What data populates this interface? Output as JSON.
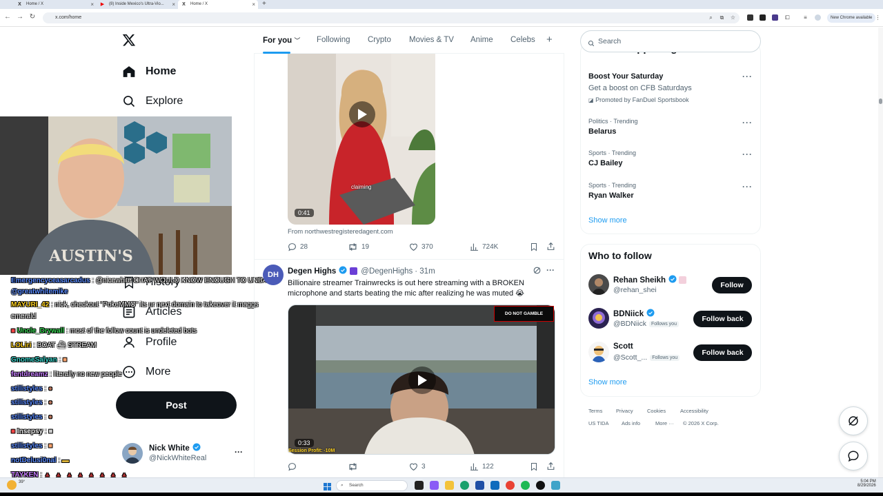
{
  "browser": {
    "tabs": [
      {
        "title": "Home / X",
        "active": false,
        "icon": "x-icon"
      },
      {
        "title": "(8) Inside Mexico's Ultra-Vio...",
        "active": false,
        "icon": "youtube-icon"
      },
      {
        "title": "Home / X",
        "active": true,
        "icon": "x-icon"
      }
    ],
    "url": "x.com/home",
    "new_chrome_badge": "New Chrome available"
  },
  "left_nav": {
    "items": [
      {
        "label": "Home",
        "icon": "home-icon",
        "active": true
      },
      {
        "label": "Explore",
        "icon": "search-icon"
      },
      {
        "label": "History",
        "icon": "bookmark-icon"
      },
      {
        "label": "Articles",
        "icon": "article-icon"
      },
      {
        "label": "Profile",
        "icon": "person-icon"
      },
      {
        "label": "More",
        "icon": "more-circle-icon"
      }
    ],
    "post_label": "Post",
    "account": {
      "name": "Nick White",
      "handle": "@NickWhiteReal"
    }
  },
  "stream_chat": [
    {
      "user": "Emergencyceasarcadus",
      "color": "#5b8cff",
      "msg": ": @nicewhite CHAT WOULD KNOW ENOUGH TO UNBAN"
    },
    {
      "user": "@greatwhitemike",
      "color": "#5b8cff",
      "msg": ""
    },
    {
      "user": "MAYURI_42",
      "color": "#ffd21f",
      "msg": ": nick, checkout \"PokeMMO\" its ur next domain to takeover it maggs"
    },
    {
      "user": "",
      "color": "#ffffff",
      "msg": "emerald"
    },
    {
      "user": "Uncle_Drywall",
      "color": "#39d353",
      "msg": ": most of the follow count is undeleted bots"
    },
    {
      "user": "LOLiri",
      "color": "#ffd21f",
      "msg": ": BOAT ⛴ STREAM"
    },
    {
      "user": "GnomeSalyan",
      "color": "#39d3c9",
      "msg": ":"
    },
    {
      "user": "fentdreamz",
      "color": "#c77dff",
      "msg": ": literally no new people"
    },
    {
      "user": "stilistyles",
      "color": "#5b8cff",
      "msg": ":"
    },
    {
      "user": "stilistyles",
      "color": "#5b8cff",
      "msg": ":"
    },
    {
      "user": "stilistyles",
      "color": "#5b8cff",
      "msg": ":"
    },
    {
      "user": "Insepsy",
      "color": "#f2f2f2",
      "msg": ":"
    },
    {
      "user": "stilistyles",
      "color": "#5b8cff",
      "msg": ":"
    },
    {
      "user": "notDelusi0nal",
      "color": "#5b8cff",
      "msg": ":"
    },
    {
      "user": "TAYKEN",
      "color": "#c77dff",
      "msg": ":"
    },
    {
      "user": "stilistyles",
      "color": "#5b8cff",
      "msg": ":"
    }
  ],
  "feed": {
    "tabs": [
      "For you",
      "Following",
      "Crypto",
      "Movies & TV",
      "Anime",
      "Celebs"
    ],
    "tweet1": {
      "video_caption": "claiming",
      "duration": "0:41",
      "source": "From northwestregisteredagent.com",
      "replies": "28",
      "reposts": "19",
      "likes": "370",
      "views": "724K"
    },
    "tweet2": {
      "avatar_text": "DH",
      "name": "Degen Highs",
      "handle": "@DegenHighs",
      "time": "· 31m",
      "text": "Billionaire streamer Trainwrecks is out here streaming with a BROKEN microphone and starts beating the mic after realizing he was muted 😭",
      "overlay_badge": "DO NOT GAMBLE",
      "session_profit": "Session Profit: -10M",
      "duration": "0:33",
      "replies": "",
      "reposts": "",
      "likes": "3",
      "views": "122"
    }
  },
  "right": {
    "search_placeholder": "Search",
    "whats_happening_title": "What's happening",
    "trends": [
      {
        "meta": "",
        "title": "Boost Your Saturday",
        "sub": "Get a boost on CFB Saturdays",
        "promoted": "Promoted by FanDuel Sportsbook"
      },
      {
        "meta": "Politics · Trending",
        "title": "Belarus"
      },
      {
        "meta": "Sports · Trending",
        "title": "CJ Bailey"
      },
      {
        "meta": "Sports · Trending",
        "title": "Ryan Walker"
      }
    ],
    "show_more": "Show more",
    "who_to_follow_title": "Who to follow",
    "who_to_follow": [
      {
        "name": "Rehan Sheikh",
        "handle": "@rehan_shei",
        "follows_you": "",
        "button": "Follow"
      },
      {
        "name": "BDNiick",
        "handle": "@BDNiick",
        "follows_you": "Follows you",
        "button": "Follow back"
      },
      {
        "name": "Scott",
        "handle": "@Scott_...",
        "follows_you": "Follows you",
        "button": "Follow back"
      }
    ],
    "footer": [
      "Terms",
      "Privacy",
      "Cookies",
      "Accessibility",
      "US TIDA",
      "Ads info",
      "More ···",
      "© 2026 X Corp."
    ]
  },
  "taskbar": {
    "search_label": "Search",
    "time": "5:04 PM",
    "date": "8/29/2026",
    "weather": "39°"
  },
  "colors": {
    "accent": "#1d9bf0",
    "text": "#0f1419",
    "muted": "#536471"
  }
}
